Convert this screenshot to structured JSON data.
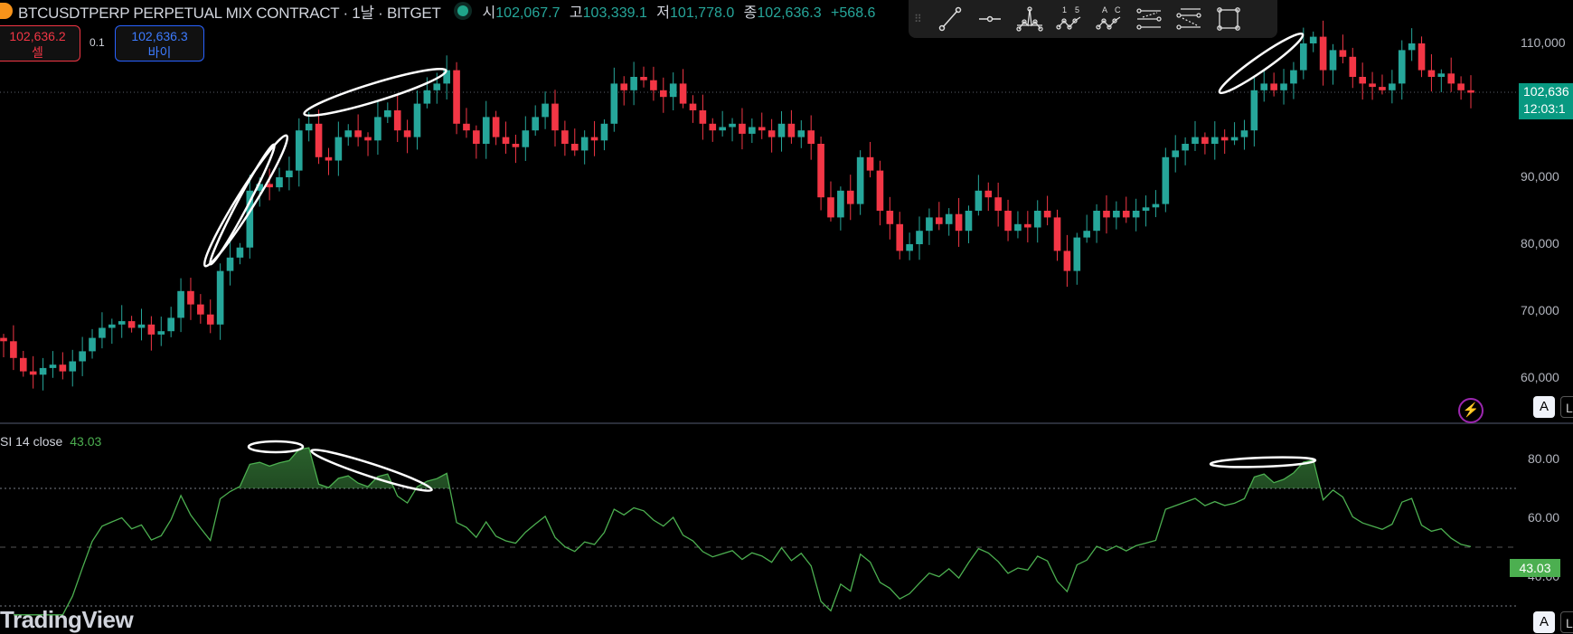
{
  "header": {
    "symbol_title": "BTCUSDTPERP PERPETUAL MIX CONTRACT · 1날 · BITGET",
    "ohlc": [
      {
        "label": "시",
        "value": "102,067.7"
      },
      {
        "label": "고",
        "value": "103,339.1"
      },
      {
        "label": "저",
        "value": "101,778.0"
      },
      {
        "label": "종",
        "value": "102,636.3"
      }
    ],
    "change": "+568.6"
  },
  "trade": {
    "sell_price": "102,636.2",
    "sell_label": "셀",
    "spread": "0.1",
    "buy_price": "102,636.3",
    "buy_label": "바이"
  },
  "toolbar": {
    "tools": [
      "trend-line-icon",
      "horizontal-ray-icon",
      "xabcd-pattern-icon",
      "elliott-wave-icon",
      "abc-pattern-icon",
      "fib-retracement-icon",
      "fib-extension-icon",
      "rectangle-icon"
    ],
    "wave_labels": [
      "1",
      "5"
    ],
    "abc_labels": [
      "A",
      "C"
    ]
  },
  "price_axis": {
    "ticks": [
      "110,000",
      "90,000",
      "80,000",
      "70,000",
      "60,000"
    ],
    "current_price": "102,636",
    "countdown": "12:03:1"
  },
  "rsi": {
    "legend": "SI 14 close",
    "value": "43.03",
    "ticks": [
      "80.00",
      "60.00",
      "40.00"
    ]
  },
  "buttons": {
    "auto": "A",
    "log": "L"
  },
  "branding": "TradingView",
  "colors": {
    "up": "#26a69a",
    "down": "#f23645",
    "rsi": "#4caf50",
    "accent": "#089981"
  },
  "chart_data": {
    "type": "candlestick",
    "interval": "1D",
    "unit": "USDT (thousands)",
    "ylim": [
      56,
      113
    ],
    "close": [
      65.5,
      63,
      61,
      60.5,
      61.5,
      62,
      61,
      62.5,
      64,
      66,
      67.5,
      68,
      68.5,
      67.5,
      68,
      66.5,
      67,
      69,
      73,
      71,
      69.5,
      68,
      76,
      78,
      79.5,
      88,
      89,
      88.5,
      90,
      91,
      97,
      98,
      93,
      92.5,
      96,
      97,
      96,
      95.5,
      99,
      100,
      97,
      96,
      101,
      103,
      104,
      106,
      98,
      97,
      95,
      99,
      96,
      95,
      94.5,
      97,
      99,
      101,
      97,
      95,
      94,
      96,
      95.5,
      98,
      104,
      103,
      105,
      104.5,
      103,
      102,
      104,
      101,
      100,
      98,
      97,
      97.5,
      98,
      96.5,
      97.5,
      97,
      96,
      98,
      96,
      97,
      95,
      87,
      84,
      88,
      86,
      93,
      91,
      85,
      83,
      79,
      80,
      82,
      84,
      83,
      84.5,
      82,
      85,
      88,
      87,
      85,
      82,
      83,
      82.5,
      85,
      84,
      79,
      76,
      81,
      82,
      85,
      84,
      85,
      84,
      85,
      85.5,
      86,
      93,
      94,
      95,
      96,
      95,
      96,
      95.5,
      96,
      97,
      103,
      104,
      103,
      104,
      106,
      110,
      111,
      106,
      109,
      108,
      105,
      104,
      103.5,
      103,
      104,
      109,
      110,
      106,
      105,
      105.5,
      104,
      103,
      102.636
    ],
    "rsi_period": 14,
    "rsi_levels": [
      70,
      50,
      30
    ],
    "rsi_ylim": [
      26,
      92
    ]
  }
}
